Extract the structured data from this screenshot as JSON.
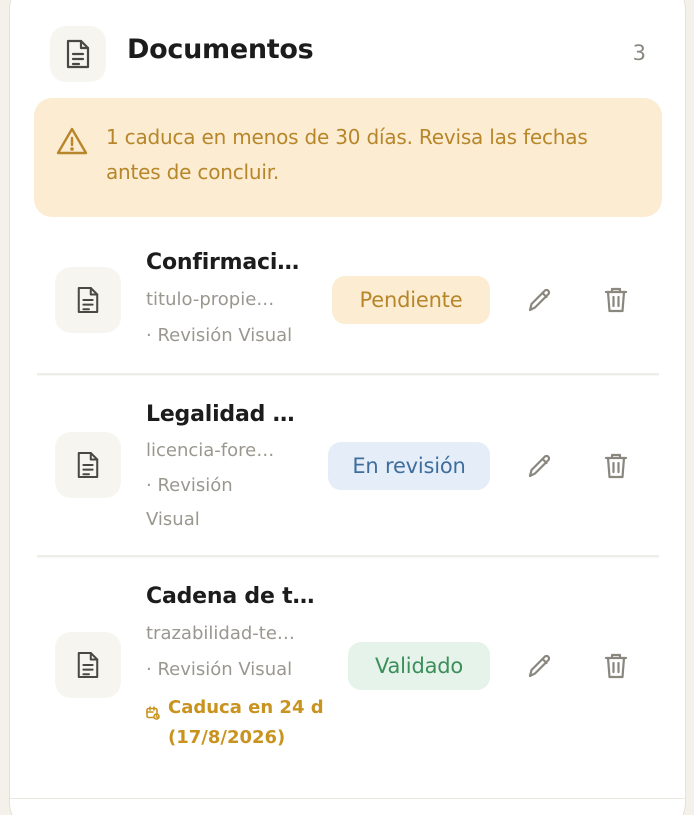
{
  "header": {
    "title": "Documentos",
    "count": "3",
    "icon": "document-icon"
  },
  "alert": {
    "icon": "warning-triangle-icon",
    "text": "1 caduca en menos de 30 días. Revisa las fechas antes de concluir."
  },
  "documents": [
    {
      "name": "Confirmaci…",
      "file": "titulo-propie…",
      "meta": "· Revisión Visual",
      "status": "Pendiente",
      "expiry": ""
    },
    {
      "name": "Legalidad …",
      "file": "licencia-fore…",
      "meta": "· Revisión Visual",
      "status": "En revisión",
      "expiry": ""
    },
    {
      "name": "Cadena de t…",
      "file": "trazabilidad-te…",
      "meta": "· Revisión Visual",
      "status": "Validado",
      "expiry": "Caduca en 24 d (17/8/2026)"
    }
  ],
  "actions": {
    "edit_icon": "pencil-icon",
    "delete_icon": "trash-icon"
  },
  "colors": {
    "warning_bg": "#fbecd2",
    "warning_text": "#b8862a",
    "pending_bg": "#fbecd2",
    "review_bg": "#e5eef8",
    "review_text": "#3f6e9d",
    "validated_bg": "#e5f3ea",
    "validated_text": "#3c8f5a",
    "expiry_text": "#c9931f"
  }
}
